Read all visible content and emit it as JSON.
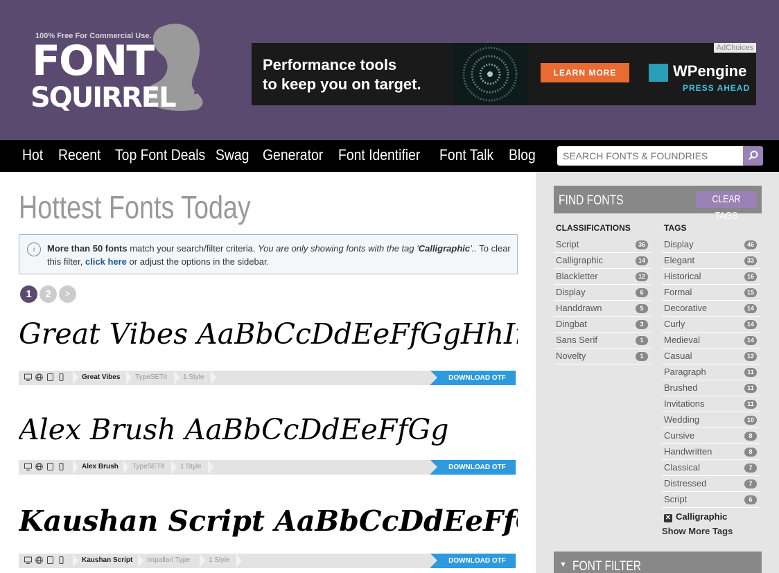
{
  "header": {
    "tagline": "100% Free For Commercial Use.",
    "logo_word1": "FONT",
    "logo_word2": "SQUIRREL"
  },
  "ad": {
    "headline_line1": "Performance tools",
    "headline_line2": "to keep you on target.",
    "cta": "LEARN MORE",
    "brand": "WPengine",
    "slogan": "PRESS AHEAD",
    "adchoices": "AdChoices"
  },
  "nav": {
    "items": [
      "Hot",
      "Recent",
      "Top Font Deals",
      "Swag",
      "Generator",
      "Font Identifier",
      "Font Talk",
      "Blog"
    ],
    "search_placeholder": "SEARCH FONTS & FOUNDRIES"
  },
  "main": {
    "title": "Hottest Fonts Today",
    "notice": {
      "bold_lead": "More than 50 fonts",
      "part1": " match your search/filter criteria. ",
      "italic_part": "You are only showing fonts with the tag '",
      "tag": "Calligraphic",
      "italic_end": "'..",
      "part2": " To clear this filter, ",
      "link": "click here",
      "part3": " or adjust the options in the sidebar."
    },
    "pages": [
      "1",
      "2",
      ">"
    ],
    "fonts": [
      {
        "sample": "Great Vibes AaBbCcDdEeFfGgHhIi",
        "name": "Great Vibes",
        "foundry": "TypeSETit",
        "styles": "1 Style",
        "download": "DOWNLOAD OTF"
      },
      {
        "sample": "Alex Brush AaBbCcDdEeFfGg",
        "name": "Alex Brush",
        "foundry": "TypeSETit",
        "styles": "1 Style",
        "download": "DOWNLOAD OTF"
      },
      {
        "sample": "Kaushan Script AaBbCcDdEeFfGgHhIi",
        "name": "Kaushan Script",
        "foundry": "Impallari Type",
        "styles": "1 Style",
        "download": "DOWNLOAD OTF"
      }
    ]
  },
  "sidebar": {
    "find_title": "FIND FONTS",
    "clear_tags": "CLEAR TAGS",
    "classifications_head": "CLASSIFICATIONS",
    "tags_head": "TAGS",
    "classifications": [
      {
        "label": "Script",
        "count": "36"
      },
      {
        "label": "Calligraphic",
        "count": "14"
      },
      {
        "label": "Blackletter",
        "count": "12"
      },
      {
        "label": "Display",
        "count": "6"
      },
      {
        "label": "Handdrawn",
        "count": "5"
      },
      {
        "label": "Dingbat",
        "count": "3"
      },
      {
        "label": "Sans Serif",
        "count": "1"
      },
      {
        "label": "Novelty",
        "count": "1"
      }
    ],
    "tags": [
      {
        "label": "Display",
        "count": "46"
      },
      {
        "label": "Elegant",
        "count": "33"
      },
      {
        "label": "Historical",
        "count": "16"
      },
      {
        "label": "Formal",
        "count": "15"
      },
      {
        "label": "Decorative",
        "count": "14"
      },
      {
        "label": "Curly",
        "count": "14"
      },
      {
        "label": "Medieval",
        "count": "14"
      },
      {
        "label": "Casual",
        "count": "12"
      },
      {
        "label": "Paragraph",
        "count": "11"
      },
      {
        "label": "Brushed",
        "count": "11"
      },
      {
        "label": "Invitations",
        "count": "11"
      },
      {
        "label": "Wedding",
        "count": "10"
      },
      {
        "label": "Cursive",
        "count": "8"
      },
      {
        "label": "Handwritten",
        "count": "8"
      },
      {
        "label": "Classical",
        "count": "7"
      },
      {
        "label": "Distressed",
        "count": "7"
      },
      {
        "label": "Script",
        "count": "6"
      }
    ],
    "active_tag": "Calligraphic",
    "show_more": "Show More Tags",
    "filter_title": "FONT FILTER"
  },
  "colors": {
    "header_bg": "#5b4a6f",
    "accent_purple": "#9a82b5",
    "download_blue": "#2e9ade",
    "pager_active": "#5b4a6f",
    "pager_inactive": "#cccccc"
  }
}
